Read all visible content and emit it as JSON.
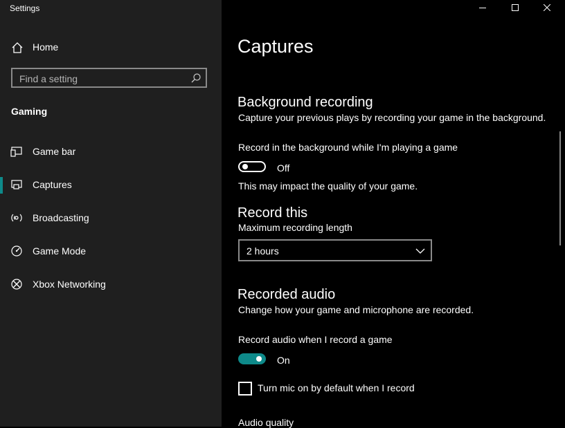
{
  "window": {
    "title": "Settings",
    "controls": [
      "minimize-icon",
      "maximize-icon",
      "close-icon"
    ]
  },
  "sidebar": {
    "home_label": "Home",
    "search_placeholder": "Find a setting",
    "group_title": "Gaming",
    "items": [
      {
        "label": "Game bar",
        "icon": "game-bar-icon",
        "selected": false
      },
      {
        "label": "Captures",
        "icon": "captures-icon",
        "selected": true
      },
      {
        "label": "Broadcasting",
        "icon": "broadcasting-icon",
        "selected": false
      },
      {
        "label": "Game Mode",
        "icon": "game-mode-icon",
        "selected": false
      },
      {
        "label": "Xbox Networking",
        "icon": "xbox-icon",
        "selected": false
      }
    ]
  },
  "main": {
    "page_title": "Captures",
    "background_recording": {
      "title": "Background recording",
      "description": "Capture your previous plays by recording your game in the background.",
      "toggle_label": "Record in the background while I'm playing a game",
      "toggle_state": "Off",
      "note": "This may impact the quality of your game."
    },
    "record_this": {
      "title": "Record this",
      "length_label": "Maximum recording length",
      "length_value": "2 hours"
    },
    "recorded_audio": {
      "title": "Recorded audio",
      "description": "Change how your game and microphone are recorded.",
      "toggle_label": "Record audio when I record a game",
      "toggle_state": "On",
      "mic_checkbox_label": "Turn mic on by default when I record",
      "mic_checked": false,
      "quality_label": "Audio quality"
    }
  },
  "colors": {
    "accent": "#0e8a8a",
    "sidebar_bg": "#1f1f1f",
    "content_bg": "#000000"
  }
}
